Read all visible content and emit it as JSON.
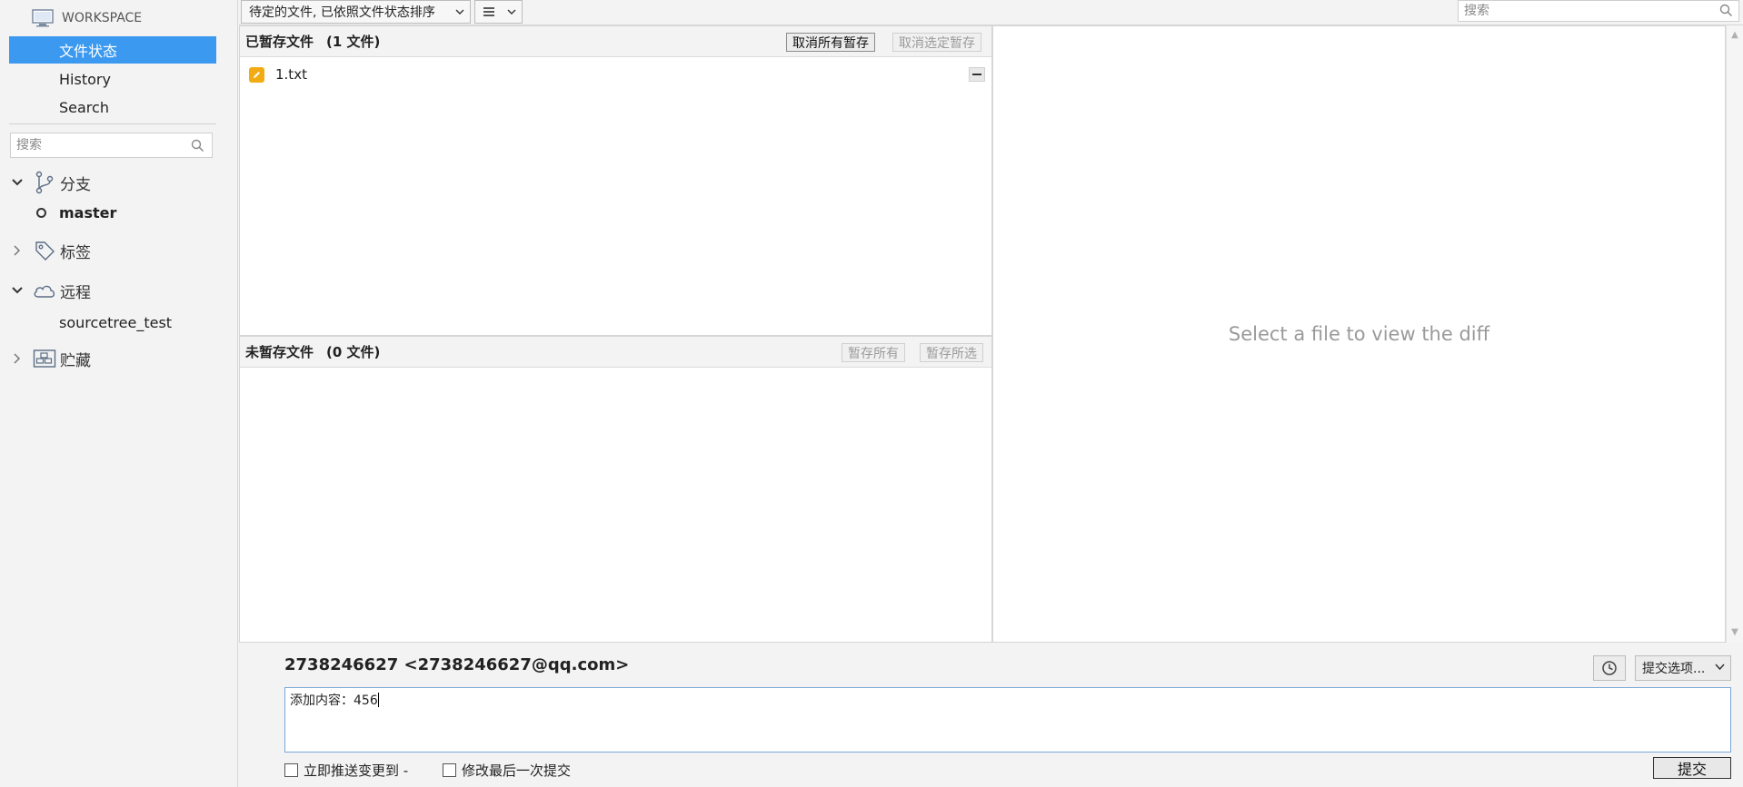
{
  "sidebar": {
    "workspace_label": "WORKSPACE",
    "nav": [
      {
        "label": "文件状态",
        "active": true
      },
      {
        "label": "History",
        "active": false
      },
      {
        "label": "Search",
        "active": false
      }
    ],
    "search_placeholder": "搜索",
    "groups": {
      "branches": {
        "label": "分支",
        "expanded": true,
        "items": [
          "master"
        ]
      },
      "tags": {
        "label": "标签",
        "expanded": false
      },
      "remotes": {
        "label": "远程",
        "expanded": true,
        "items": [
          "sourcetree_test"
        ]
      },
      "stashes": {
        "label": "贮藏",
        "expanded": false
      }
    }
  },
  "toolbar": {
    "filter_dropdown": "待定的文件, 已依照文件状态排序",
    "view_dropdown_icon": "list-icon",
    "search_placeholder": "搜索"
  },
  "staged": {
    "title": "已暂存文件",
    "count": "(1 文件)",
    "unstage_all": "取消所有暂存",
    "unstage_selected": "取消选定暂存",
    "files": [
      {
        "name": "1.txt",
        "status": "modified"
      }
    ]
  },
  "unstaged": {
    "title": "未暂存文件",
    "count": "(0 文件)",
    "stage_all": "暂存所有",
    "stage_selected": "暂存所选",
    "files": []
  },
  "diff": {
    "placeholder": "Select a file to view the diff"
  },
  "commit": {
    "author": "2738246627 <2738246627@qq.com>",
    "options_label": "提交选项...",
    "message": "添加内容：456",
    "push_label": "立即推送变更到 -",
    "amend_label": "修改最后一次提交",
    "submit_label": "提交"
  },
  "colors": {
    "accent": "#3c99f0",
    "modified_icon": "#f2ac13"
  }
}
